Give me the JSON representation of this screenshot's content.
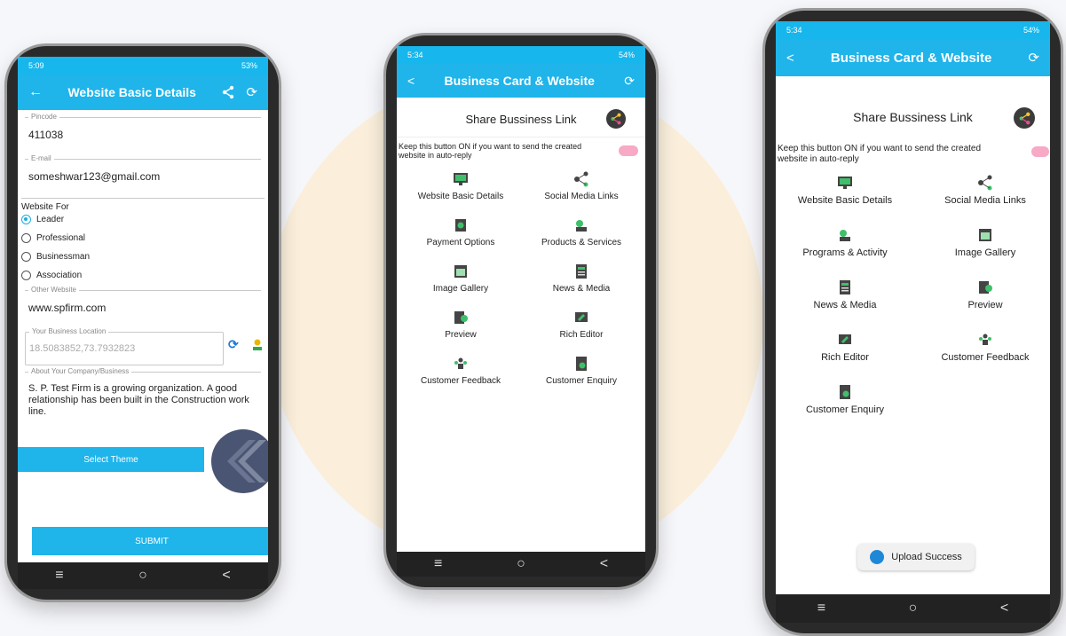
{
  "phone1": {
    "status": {
      "time": "5:09",
      "indicators": "53%"
    },
    "title": "Website Basic Details",
    "pincode": {
      "label": "Pincode",
      "value": "411038"
    },
    "email": {
      "label": "E-mail",
      "value": "someshwar123@gmail.com"
    },
    "website_for": {
      "label": "Website For",
      "options": [
        "Leader",
        "Professional",
        "Businessman",
        "Association"
      ],
      "selected": "Leader"
    },
    "other_website": {
      "label": "Other Website",
      "value": "www.spfirm.com"
    },
    "location": {
      "label": "Your Business Location",
      "value": "18.5083852,73.7932823"
    },
    "about": {
      "label": "About Your Company/Business",
      "value": "S. P. Test Firm is a growing organization. A good relationship has been built in the Construction work line."
    },
    "select_theme": "Select Theme",
    "submit": "SUBMIT"
  },
  "phone2": {
    "status": {
      "time": "5:34",
      "indicators": "54%"
    },
    "title": "Business Card & Website",
    "share_label": "Share Bussiness Link",
    "keep_text": "Keep this button ON if you want to send the created website in auto-reply",
    "items": [
      "Website Basic Details",
      "Social Media Links",
      "Payment Options",
      "Products & Services",
      "Image Gallery",
      "News & Media",
      "Preview",
      "Rich Editor",
      "Customer Feedback",
      "Customer Enquiry"
    ]
  },
  "phone3": {
    "status": {
      "time": "5:34",
      "indicators": "54%"
    },
    "title": "Business Card & Website",
    "share_label": "Share Bussiness Link",
    "keep_text": "Keep this button ON if you want to send the created website in auto-reply",
    "items": [
      "Website Basic Details",
      "Social Media Links",
      "Programs & Activity",
      "Image Gallery",
      "News & Media",
      "Preview",
      "Rich Editor",
      "Customer Feedback",
      "Customer Enquiry"
    ],
    "toast": "Upload Success"
  },
  "nav_glyphs": {
    "menu": "≡",
    "home": "○",
    "back": "<"
  },
  "colors": {
    "primary": "#1fb4ea",
    "accent": "#f2386b",
    "background_blob": "#fbefdc"
  }
}
